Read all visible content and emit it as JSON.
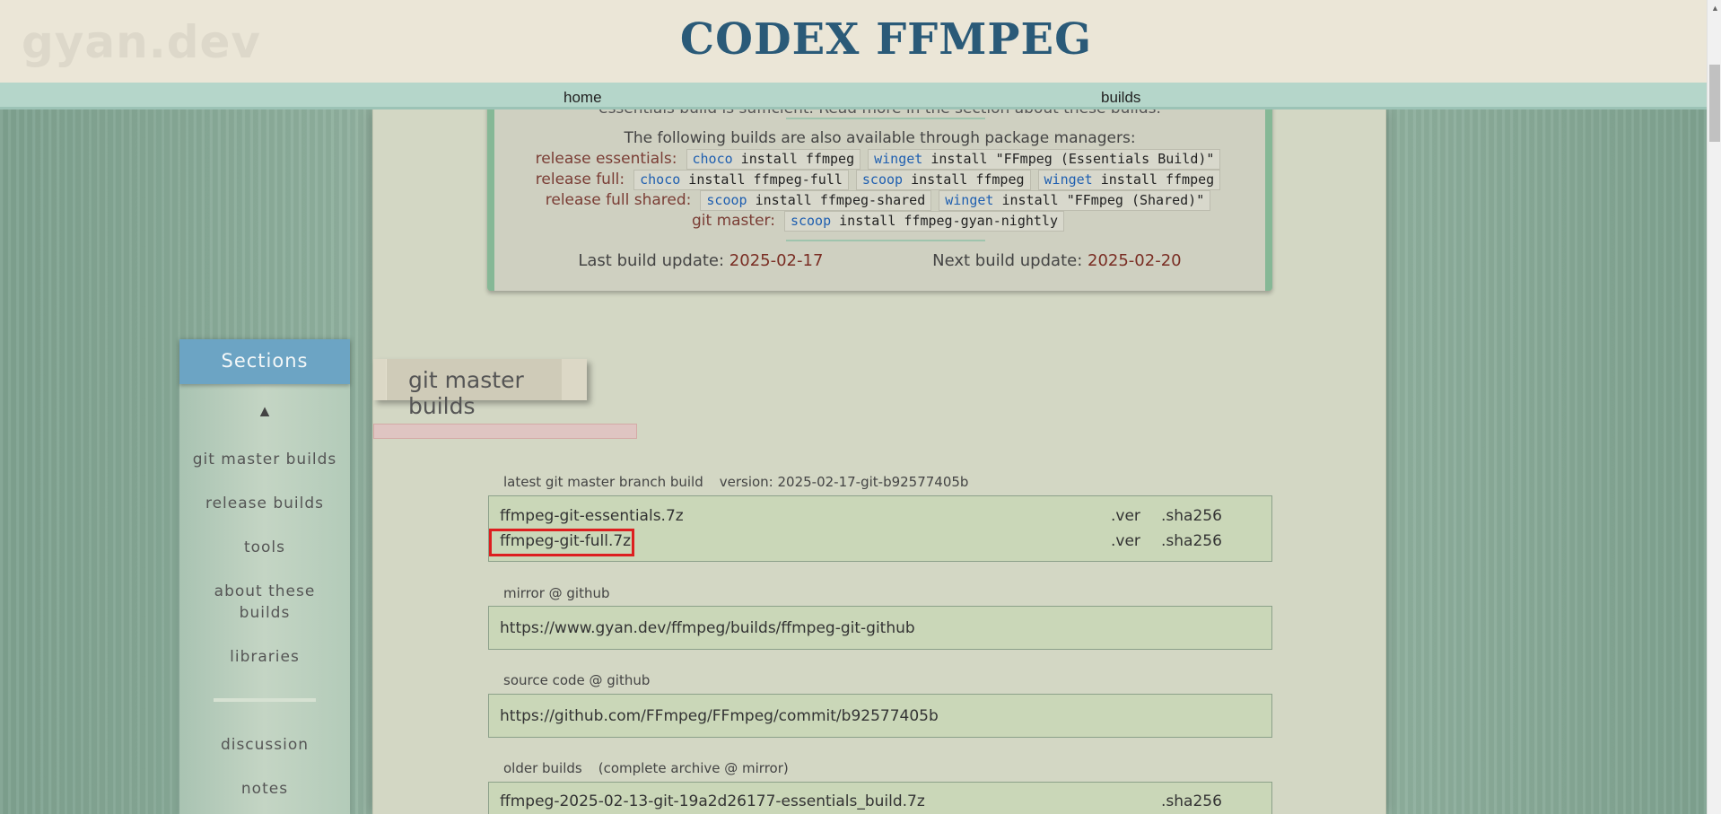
{
  "header": {
    "logo": "gyan.dev",
    "title": "CODEX FFMPEG"
  },
  "nav": {
    "home": "home",
    "builds": "builds"
  },
  "info": {
    "clipped_text": "essentials build is sufficient. Read more in the section about these builds.",
    "pm_intro": "The following builds are also available through package managers:",
    "rows": [
      {
        "label": "release essentials:",
        "cmds": [
          [
            "choco",
            " install ffmpeg"
          ],
          [
            "winget",
            " install \"FFmpeg (Essentials Build)\""
          ]
        ]
      },
      {
        "label": "release full:",
        "cmds": [
          [
            "choco",
            " install ffmpeg-full"
          ],
          [
            "scoop",
            " install ffmpeg"
          ],
          [
            "winget",
            " install ffmpeg"
          ]
        ]
      },
      {
        "label": "release full shared:",
        "cmds": [
          [
            "scoop",
            " install ffmpeg-shared"
          ],
          [
            "winget",
            " install \"FFmpeg (Shared)\""
          ]
        ]
      },
      {
        "label": "git master:",
        "cmds": [
          [
            "scoop",
            " install ffmpeg-gyan-nightly"
          ]
        ]
      }
    ],
    "last_update_label": "Last build update:",
    "last_update": "2025-02-17",
    "next_update_label": "Next build update:",
    "next_update": "2025-02-20"
  },
  "section": {
    "title": "git master builds"
  },
  "latest": {
    "label": "latest git master branch build",
    "version": "version: 2025-02-17-git-b92577405b",
    "files": [
      {
        "name": "ffmpeg-git-essentials.7z",
        "ver": ".ver",
        "sha": ".sha256"
      },
      {
        "name": "ffmpeg-git-full.7z",
        "ver": ".ver",
        "sha": ".sha256"
      }
    ]
  },
  "mirror": {
    "label": "mirror @ github",
    "url": "https://www.gyan.dev/ffmpeg/builds/ffmpeg-git-github"
  },
  "source": {
    "label": "source code @ github",
    "url": "https://github.com/FFmpeg/FFmpeg/commit/b92577405b"
  },
  "older": {
    "label": "older builds",
    "archive": "(complete archive @ mirror)",
    "files": [
      {
        "name": "ffmpeg-2025-02-13-git-19a2d26177-essentials_build.7z",
        "sha": ".sha256"
      }
    ]
  },
  "sidebar": {
    "title": "Sections",
    "up": "▲",
    "items": [
      "git master builds",
      "release builds",
      "tools",
      "about these builds",
      "libraries",
      "discussion",
      "notes"
    ]
  },
  "colors": {
    "title": "#2a5a78",
    "highlight": "#dd1f1f",
    "date": "#7a2e24",
    "package_manager_keyword": "#1f5fb0"
  }
}
